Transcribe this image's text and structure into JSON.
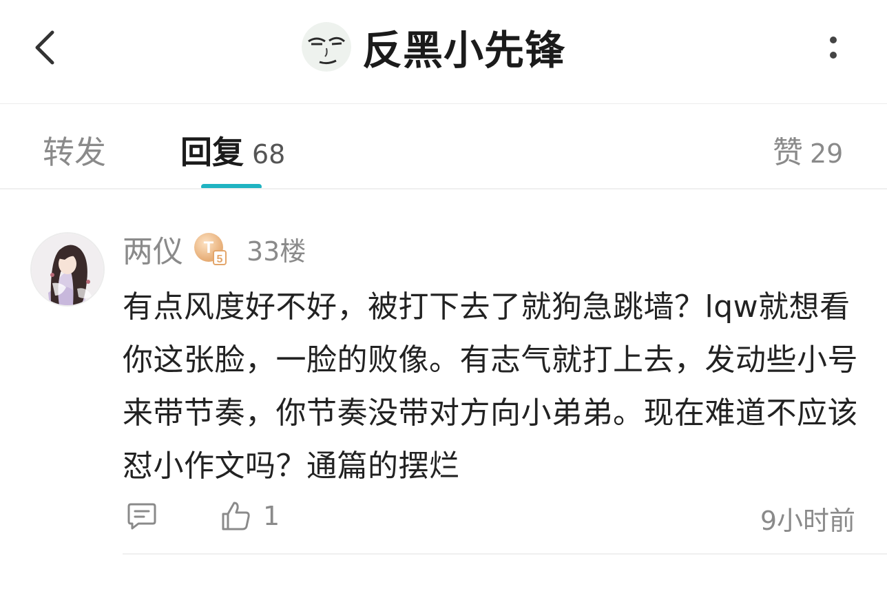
{
  "header": {
    "title": "反黑小先锋",
    "back_icon": "chevron-left-icon",
    "more_icon": "more-vertical-icon"
  },
  "tabs": {
    "forward_label": "转发",
    "reply_label": "回复",
    "reply_count": "68",
    "like_label": "赞",
    "like_count": "29",
    "active": "reply",
    "accent_color": "#1fb3c1"
  },
  "comment": {
    "username": "两仪",
    "badge_letter": "T",
    "badge_level": "5",
    "floor": "33楼",
    "text": "有点风度好不好，被打下去了就狗急跳墙？lqw就想看你这张脸，一脸的败像。有志气就打上去，发动些小号来带节奏，你节奏没带对方向小弟弟。现在难道不应该怼小作文吗？通篇的摆烂",
    "like_count": "1",
    "time": "9小时前",
    "reply_icon": "comment-icon",
    "like_icon": "thumbs-up-icon"
  }
}
